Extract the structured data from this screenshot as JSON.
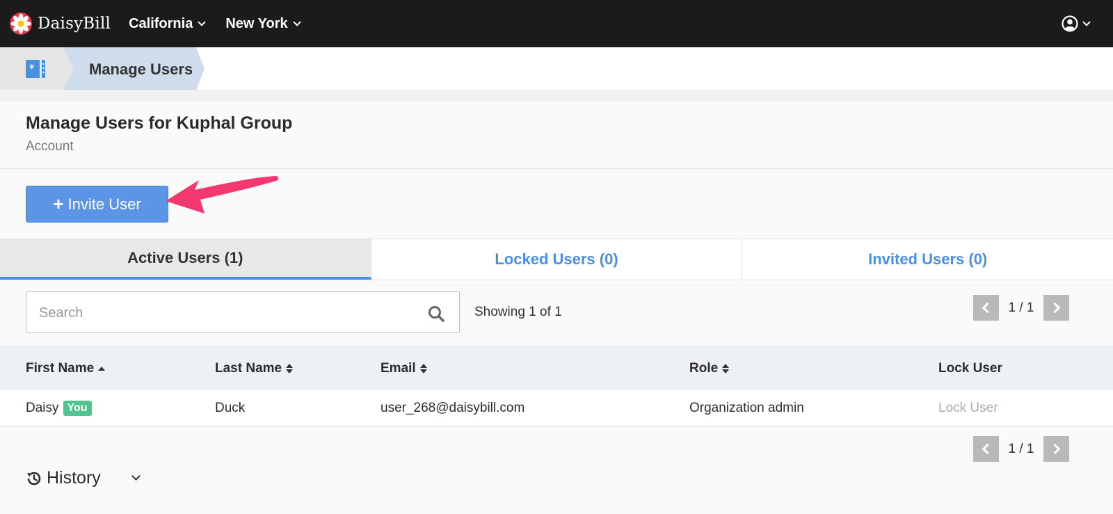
{
  "nav": {
    "brand": "DaisyBill",
    "items": [
      {
        "label": "California"
      },
      {
        "label": "New York"
      }
    ]
  },
  "breadcrumb": {
    "current": "Manage Users"
  },
  "page": {
    "title": "Manage Users for Kuphal Group",
    "subtitle": "Account"
  },
  "actions": {
    "invite_label": "Invite User"
  },
  "tabs": [
    {
      "label": "Active Users (1)",
      "active": true
    },
    {
      "label": "Locked Users (0)",
      "active": false
    },
    {
      "label": "Invited Users (0)",
      "active": false
    }
  ],
  "search": {
    "placeholder": "Search",
    "value": ""
  },
  "results": {
    "showing": "Showing 1 of 1"
  },
  "pagination": {
    "top": "1 / 1",
    "bottom": "1 / 1"
  },
  "table": {
    "headers": {
      "first_name": "First Name",
      "last_name": "Last Name",
      "email": "Email",
      "role": "Role",
      "lock_user": "Lock User"
    },
    "rows": [
      {
        "first_name": "Daisy",
        "badge": "You",
        "last_name": "Duck",
        "email": "user_268@daisybill.com",
        "role": "Organization admin",
        "lock": "Lock User"
      }
    ]
  },
  "history": {
    "label": "History"
  },
  "colors": {
    "nav_bg": "#1b1b1b",
    "primary_button": "#5c95e6",
    "tab_link": "#4a90e2",
    "badge_green": "#4cc58f",
    "annotation_arrow": "#f2386f"
  },
  "icons": {
    "brand": "daisy-flower-icon",
    "user": "user-circle-icon",
    "home": "id-card-icon",
    "invite": "plus-icon",
    "search": "magnifier-icon",
    "history": "history-clock-icon",
    "pager_prev": "chevron-left-icon",
    "pager_next": "chevron-right-icon"
  }
}
